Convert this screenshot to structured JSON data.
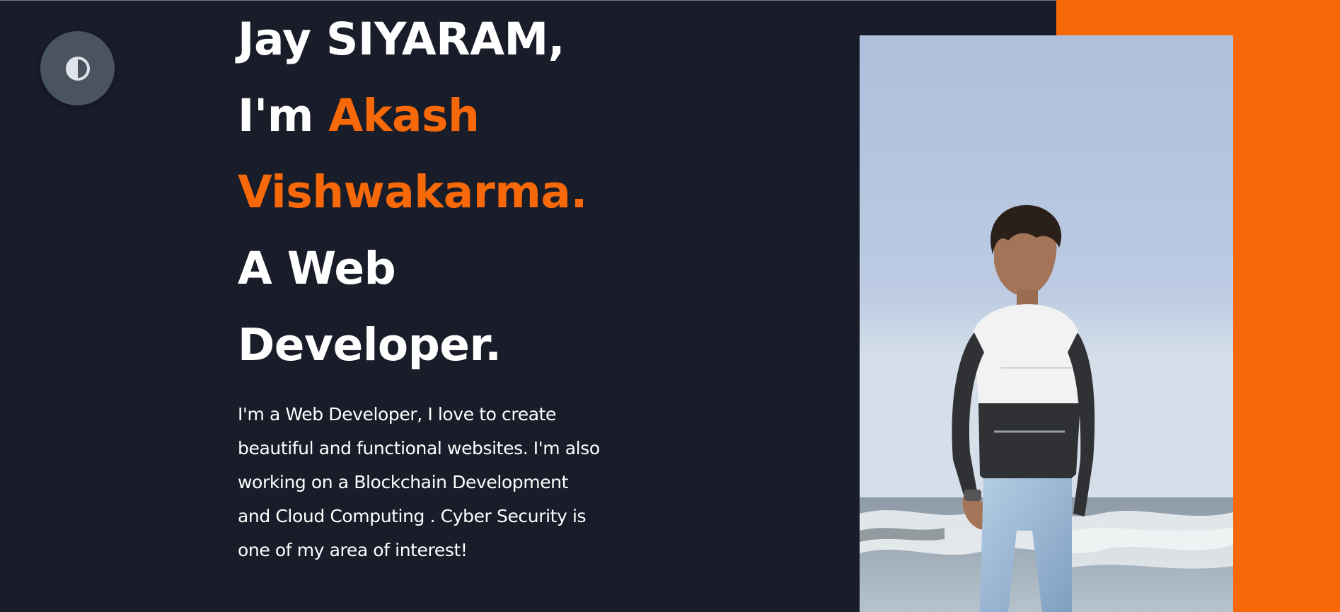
{
  "hero": {
    "greeting": "Jay SIYARAM,",
    "intro_prefix": "I'm ",
    "name_first": "Akash",
    "name_last": "Vishwakarma.",
    "role_line1": "A Web",
    "role_line2": "Developer.",
    "description": "I'm a Web Developer, I love to create beautiful and functional websites. I'm also working on a Blockchain Development and Cloud Computing . Cyber Security is one of my area of interest!"
  },
  "theme_toggle": {
    "icon": "contrast-icon"
  },
  "profile_photo": {
    "icon": "person-photo"
  },
  "colors": {
    "background": "#191c29",
    "accent": "#f76808",
    "text": "#ffffff",
    "toggle": "#4a5360"
  }
}
